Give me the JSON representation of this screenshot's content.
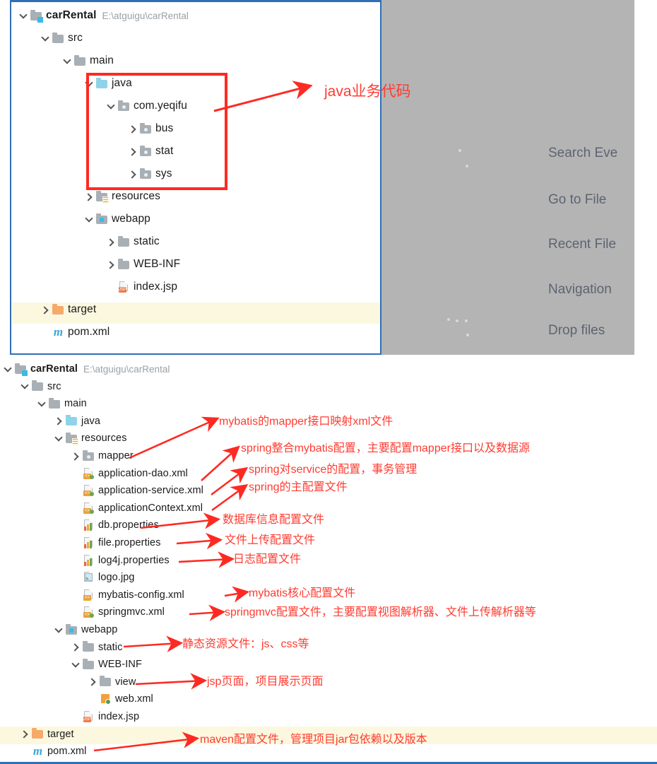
{
  "top_panel": {
    "tree": [
      {
        "indent": 0,
        "toggle": "down",
        "icon": "module-folder",
        "label": "carRental",
        "bold": true,
        "path": "E:\\atguigu\\carRental"
      },
      {
        "indent": 1,
        "toggle": "down",
        "icon": "folder",
        "label": "src"
      },
      {
        "indent": 2,
        "toggle": "down",
        "icon": "folder",
        "label": "main"
      },
      {
        "indent": 3,
        "toggle": "down",
        "icon": "source-folder",
        "label": "java"
      },
      {
        "indent": 4,
        "toggle": "down",
        "icon": "package",
        "label": "com.yeqifu"
      },
      {
        "indent": 5,
        "toggle": "right",
        "icon": "package",
        "label": "bus"
      },
      {
        "indent": 5,
        "toggle": "right",
        "icon": "package",
        "label": "stat"
      },
      {
        "indent": 5,
        "toggle": "right",
        "icon": "package",
        "label": "sys"
      },
      {
        "indent": 3,
        "toggle": "right",
        "icon": "resources-folder",
        "label": "resources"
      },
      {
        "indent": 3,
        "toggle": "down",
        "icon": "webapp-folder",
        "label": "webapp"
      },
      {
        "indent": 4,
        "toggle": "right",
        "icon": "folder",
        "label": "static"
      },
      {
        "indent": 4,
        "toggle": "right",
        "icon": "folder",
        "label": "WEB-INF"
      },
      {
        "indent": 4,
        "toggle": "none",
        "icon": "jsp-file",
        "label": "index.jsp"
      },
      {
        "indent": 1,
        "toggle": "right",
        "icon": "target-folder",
        "label": "target",
        "highlight": true
      },
      {
        "indent": 1,
        "toggle": "none",
        "icon": "maven-m",
        "label": "pom.xml"
      }
    ]
  },
  "editor_hints": [
    "Search Eve",
    "Go to File",
    "Recent File",
    "Navigation",
    "Drop files"
  ],
  "bottom_panel": {
    "tree": [
      {
        "indent": 0,
        "toggle": "down",
        "icon": "module-folder",
        "label": "carRental",
        "bold": true,
        "path": "E:\\atguigu\\carRental"
      },
      {
        "indent": 1,
        "toggle": "down",
        "icon": "folder",
        "label": "src"
      },
      {
        "indent": 2,
        "toggle": "down",
        "icon": "folder",
        "label": "main"
      },
      {
        "indent": 3,
        "toggle": "right",
        "icon": "source-folder",
        "label": "java"
      },
      {
        "indent": 3,
        "toggle": "down",
        "icon": "resources-folder",
        "label": "resources"
      },
      {
        "indent": 4,
        "toggle": "right",
        "icon": "package",
        "label": "mapper"
      },
      {
        "indent": 4,
        "toggle": "none",
        "icon": "spring-xml-file",
        "label": "application-dao.xml"
      },
      {
        "indent": 4,
        "toggle": "none",
        "icon": "spring-xml-file",
        "label": "application-service.xml"
      },
      {
        "indent": 4,
        "toggle": "none",
        "icon": "spring-xml-file",
        "label": "applicationContext.xml"
      },
      {
        "indent": 4,
        "toggle": "none",
        "icon": "properties-file",
        "label": "db.properties"
      },
      {
        "indent": 4,
        "toggle": "none",
        "icon": "properties-file",
        "label": "file.properties"
      },
      {
        "indent": 4,
        "toggle": "none",
        "icon": "properties-file",
        "label": "log4j.properties"
      },
      {
        "indent": 4,
        "toggle": "none",
        "icon": "image-file",
        "label": "logo.jpg"
      },
      {
        "indent": 4,
        "toggle": "none",
        "icon": "xml-file",
        "label": "mybatis-config.xml"
      },
      {
        "indent": 4,
        "toggle": "none",
        "icon": "spring-xml-file",
        "label": "springmvc.xml"
      },
      {
        "indent": 3,
        "toggle": "down",
        "icon": "webapp-folder",
        "label": "webapp"
      },
      {
        "indent": 4,
        "toggle": "right",
        "icon": "folder",
        "label": "static"
      },
      {
        "indent": 4,
        "toggle": "down",
        "icon": "folder",
        "label": "WEB-INF"
      },
      {
        "indent": 5,
        "toggle": "right",
        "icon": "folder",
        "label": "view"
      },
      {
        "indent": 5,
        "toggle": "none",
        "icon": "webxml-file",
        "label": "web.xml"
      },
      {
        "indent": 4,
        "toggle": "none",
        "icon": "jsp-file",
        "label": "index.jsp"
      },
      {
        "indent": 1,
        "toggle": "right",
        "icon": "target-folder",
        "label": "target",
        "highlight": true
      },
      {
        "indent": 1,
        "toggle": "none",
        "icon": "maven-m",
        "label": "pom.xml"
      }
    ]
  },
  "annotations": {
    "java_business_code": "java业务代码",
    "mapper_xml": "mybatis的mapper接口映射xml文件",
    "spring_mybatis": "spring整合mybatis配置，主要配置mapper接口以及数据源",
    "spring_service": "spring对service的配置，事务管理",
    "spring_main": "spring的主配置文件",
    "db_config": "数据库信息配置文件",
    "file_upload": "文件上传配置文件",
    "log_config": "日志配置文件",
    "mybatis_core": "mybatis核心配置文件",
    "springmvc_config": "springmvc配置文件，主要配置视图解析器、文件上传解析器等",
    "static_res": "静态资源文件：js、css等",
    "jsp_pages": "jsp页面，项目展示页面",
    "maven_config": "maven配置文件，管理项目jar包依赖以及版本"
  },
  "colors": {
    "annotation_red": "#ff3b30",
    "panel_border_blue": "#2f6fb5",
    "editor_gray": "#b4b4b4",
    "highlight_yellow": "#fcf8df",
    "source_folder_blue": "#8fd3e8",
    "target_folder_orange": "#f5a96b"
  },
  "icon_tags": {
    "xml": "<>",
    "jsp": "JSP"
  }
}
